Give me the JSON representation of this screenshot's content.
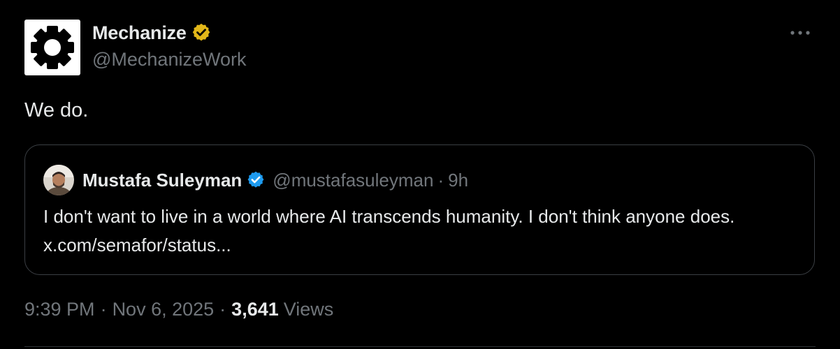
{
  "author": {
    "name": "Mechanize",
    "handle": "@MechanizeWork",
    "avatar_icon": "gear-icon",
    "verified_badge": "gold-verified-badge"
  },
  "tweet": {
    "text": "We do."
  },
  "quote": {
    "author_name": "Mustafa Suleyman",
    "author_handle": "@mustafasuleyman",
    "separator": "·",
    "time": "9h",
    "verified_badge": "blue-verified-badge",
    "text": "I don't want to live in a world where AI transcends humanity. I don't think anyone does. x.com/semafor/status..."
  },
  "meta": {
    "time": "9:39 PM",
    "date": "Nov 6, 2025",
    "separator": "·",
    "views_count": "3,641",
    "views_label": "Views"
  },
  "colors": {
    "background": "#000000",
    "text_primary": "#e7e9ea",
    "text_secondary": "#71767b",
    "verified_gold": "#e2b719",
    "verified_blue": "#1d9bf0",
    "border": "#3b3f44"
  },
  "icons": {
    "more": "more-dots-icon"
  }
}
